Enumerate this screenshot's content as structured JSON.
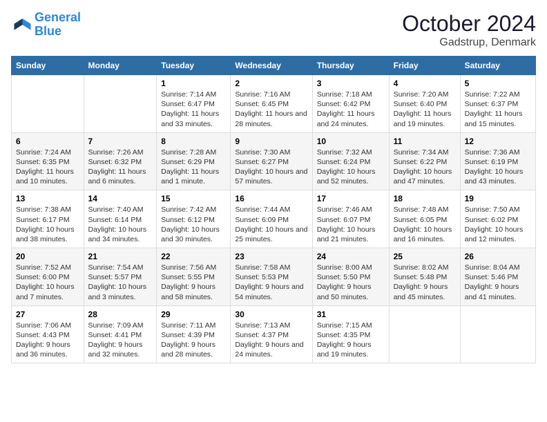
{
  "header": {
    "logo_line1": "General",
    "logo_line2": "Blue",
    "title": "October 2024",
    "subtitle": "Gadstrup, Denmark"
  },
  "days_of_week": [
    "Sunday",
    "Monday",
    "Tuesday",
    "Wednesday",
    "Thursday",
    "Friday",
    "Saturday"
  ],
  "weeks": [
    [
      {
        "day": "",
        "sunrise": "",
        "sunset": "",
        "daylight": ""
      },
      {
        "day": "",
        "sunrise": "",
        "sunset": "",
        "daylight": ""
      },
      {
        "day": "1",
        "sunrise": "Sunrise: 7:14 AM",
        "sunset": "Sunset: 6:47 PM",
        "daylight": "Daylight: 11 hours and 33 minutes."
      },
      {
        "day": "2",
        "sunrise": "Sunrise: 7:16 AM",
        "sunset": "Sunset: 6:45 PM",
        "daylight": "Daylight: 11 hours and 28 minutes."
      },
      {
        "day": "3",
        "sunrise": "Sunrise: 7:18 AM",
        "sunset": "Sunset: 6:42 PM",
        "daylight": "Daylight: 11 hours and 24 minutes."
      },
      {
        "day": "4",
        "sunrise": "Sunrise: 7:20 AM",
        "sunset": "Sunset: 6:40 PM",
        "daylight": "Daylight: 11 hours and 19 minutes."
      },
      {
        "day": "5",
        "sunrise": "Sunrise: 7:22 AM",
        "sunset": "Sunset: 6:37 PM",
        "daylight": "Daylight: 11 hours and 15 minutes."
      }
    ],
    [
      {
        "day": "6",
        "sunrise": "Sunrise: 7:24 AM",
        "sunset": "Sunset: 6:35 PM",
        "daylight": "Daylight: 11 hours and 10 minutes."
      },
      {
        "day": "7",
        "sunrise": "Sunrise: 7:26 AM",
        "sunset": "Sunset: 6:32 PM",
        "daylight": "Daylight: 11 hours and 6 minutes."
      },
      {
        "day": "8",
        "sunrise": "Sunrise: 7:28 AM",
        "sunset": "Sunset: 6:29 PM",
        "daylight": "Daylight: 11 hours and 1 minute."
      },
      {
        "day": "9",
        "sunrise": "Sunrise: 7:30 AM",
        "sunset": "Sunset: 6:27 PM",
        "daylight": "Daylight: 10 hours and 57 minutes."
      },
      {
        "day": "10",
        "sunrise": "Sunrise: 7:32 AM",
        "sunset": "Sunset: 6:24 PM",
        "daylight": "Daylight: 10 hours and 52 minutes."
      },
      {
        "day": "11",
        "sunrise": "Sunrise: 7:34 AM",
        "sunset": "Sunset: 6:22 PM",
        "daylight": "Daylight: 10 hours and 47 minutes."
      },
      {
        "day": "12",
        "sunrise": "Sunrise: 7:36 AM",
        "sunset": "Sunset: 6:19 PM",
        "daylight": "Daylight: 10 hours and 43 minutes."
      }
    ],
    [
      {
        "day": "13",
        "sunrise": "Sunrise: 7:38 AM",
        "sunset": "Sunset: 6:17 PM",
        "daylight": "Daylight: 10 hours and 38 minutes."
      },
      {
        "day": "14",
        "sunrise": "Sunrise: 7:40 AM",
        "sunset": "Sunset: 6:14 PM",
        "daylight": "Daylight: 10 hours and 34 minutes."
      },
      {
        "day": "15",
        "sunrise": "Sunrise: 7:42 AM",
        "sunset": "Sunset: 6:12 PM",
        "daylight": "Daylight: 10 hours and 30 minutes."
      },
      {
        "day": "16",
        "sunrise": "Sunrise: 7:44 AM",
        "sunset": "Sunset: 6:09 PM",
        "daylight": "Daylight: 10 hours and 25 minutes."
      },
      {
        "day": "17",
        "sunrise": "Sunrise: 7:46 AM",
        "sunset": "Sunset: 6:07 PM",
        "daylight": "Daylight: 10 hours and 21 minutes."
      },
      {
        "day": "18",
        "sunrise": "Sunrise: 7:48 AM",
        "sunset": "Sunset: 6:05 PM",
        "daylight": "Daylight: 10 hours and 16 minutes."
      },
      {
        "day": "19",
        "sunrise": "Sunrise: 7:50 AM",
        "sunset": "Sunset: 6:02 PM",
        "daylight": "Daylight: 10 hours and 12 minutes."
      }
    ],
    [
      {
        "day": "20",
        "sunrise": "Sunrise: 7:52 AM",
        "sunset": "Sunset: 6:00 PM",
        "daylight": "Daylight: 10 hours and 7 minutes."
      },
      {
        "day": "21",
        "sunrise": "Sunrise: 7:54 AM",
        "sunset": "Sunset: 5:57 PM",
        "daylight": "Daylight: 10 hours and 3 minutes."
      },
      {
        "day": "22",
        "sunrise": "Sunrise: 7:56 AM",
        "sunset": "Sunset: 5:55 PM",
        "daylight": "Daylight: 9 hours and 58 minutes."
      },
      {
        "day": "23",
        "sunrise": "Sunrise: 7:58 AM",
        "sunset": "Sunset: 5:53 PM",
        "daylight": "Daylight: 9 hours and 54 minutes."
      },
      {
        "day": "24",
        "sunrise": "Sunrise: 8:00 AM",
        "sunset": "Sunset: 5:50 PM",
        "daylight": "Daylight: 9 hours and 50 minutes."
      },
      {
        "day": "25",
        "sunrise": "Sunrise: 8:02 AM",
        "sunset": "Sunset: 5:48 PM",
        "daylight": "Daylight: 9 hours and 45 minutes."
      },
      {
        "day": "26",
        "sunrise": "Sunrise: 8:04 AM",
        "sunset": "Sunset: 5:46 PM",
        "daylight": "Daylight: 9 hours and 41 minutes."
      }
    ],
    [
      {
        "day": "27",
        "sunrise": "Sunrise: 7:06 AM",
        "sunset": "Sunset: 4:43 PM",
        "daylight": "Daylight: 9 hours and 36 minutes."
      },
      {
        "day": "28",
        "sunrise": "Sunrise: 7:09 AM",
        "sunset": "Sunset: 4:41 PM",
        "daylight": "Daylight: 9 hours and 32 minutes."
      },
      {
        "day": "29",
        "sunrise": "Sunrise: 7:11 AM",
        "sunset": "Sunset: 4:39 PM",
        "daylight": "Daylight: 9 hours and 28 minutes."
      },
      {
        "day": "30",
        "sunrise": "Sunrise: 7:13 AM",
        "sunset": "Sunset: 4:37 PM",
        "daylight": "Daylight: 9 hours and 24 minutes."
      },
      {
        "day": "31",
        "sunrise": "Sunrise: 7:15 AM",
        "sunset": "Sunset: 4:35 PM",
        "daylight": "Daylight: 9 hours and 19 minutes."
      },
      {
        "day": "",
        "sunrise": "",
        "sunset": "",
        "daylight": ""
      },
      {
        "day": "",
        "sunrise": "",
        "sunset": "",
        "daylight": ""
      }
    ]
  ]
}
